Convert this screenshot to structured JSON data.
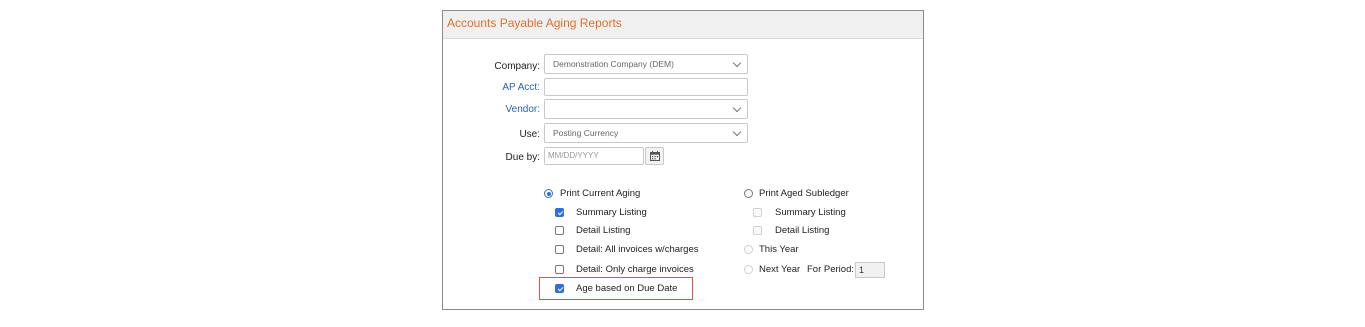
{
  "header": {
    "title": "Accounts Payable Aging Reports"
  },
  "form": {
    "company": {
      "label": "Company:",
      "value": "Demonstration Company (DEM)"
    },
    "ap_acct": {
      "label": "AP Acct:",
      "value": ""
    },
    "vendor": {
      "label": "Vendor:",
      "value": ""
    },
    "use": {
      "label": "Use:",
      "value": "Posting Currency"
    },
    "due_by": {
      "label": "Due by:",
      "placeholder": "MM/DD/YYYY"
    }
  },
  "options_left": {
    "print_current_aging": {
      "label": "Print Current Aging",
      "selected": true
    },
    "summary_listing": {
      "label": "Summary Listing",
      "checked": true
    },
    "detail_listing": {
      "label": "Detail Listing",
      "checked": false
    },
    "detail_all_invoices": {
      "label": "Detail: All invoices w/charges",
      "checked": false
    },
    "detail_only_charge": {
      "label": "Detail: Only charge invoices",
      "checked": false
    },
    "age_based_on_due_date": {
      "label": "Age based on Due Date",
      "checked": true
    }
  },
  "options_right": {
    "print_aged_subledger": {
      "label": "Print Aged Subledger",
      "selected": false
    },
    "summary_listing": {
      "label": "Summary Listing",
      "checked": false
    },
    "detail_listing": {
      "label": "Detail Listing",
      "checked": false
    },
    "this_year": {
      "label": "This Year",
      "selected": false
    },
    "next_year": {
      "label": "Next Year",
      "selected": false
    },
    "for_period": {
      "label": "For Period:",
      "value": "1"
    }
  },
  "colors": {
    "header_title": "#e16f2c",
    "link_label": "#2a62b0",
    "accent": "#2f6fd6",
    "highlight_border": "#d9534f"
  },
  "icons": {
    "dropdown": "chevron-down-icon",
    "date_picker": "calendar-icon"
  }
}
